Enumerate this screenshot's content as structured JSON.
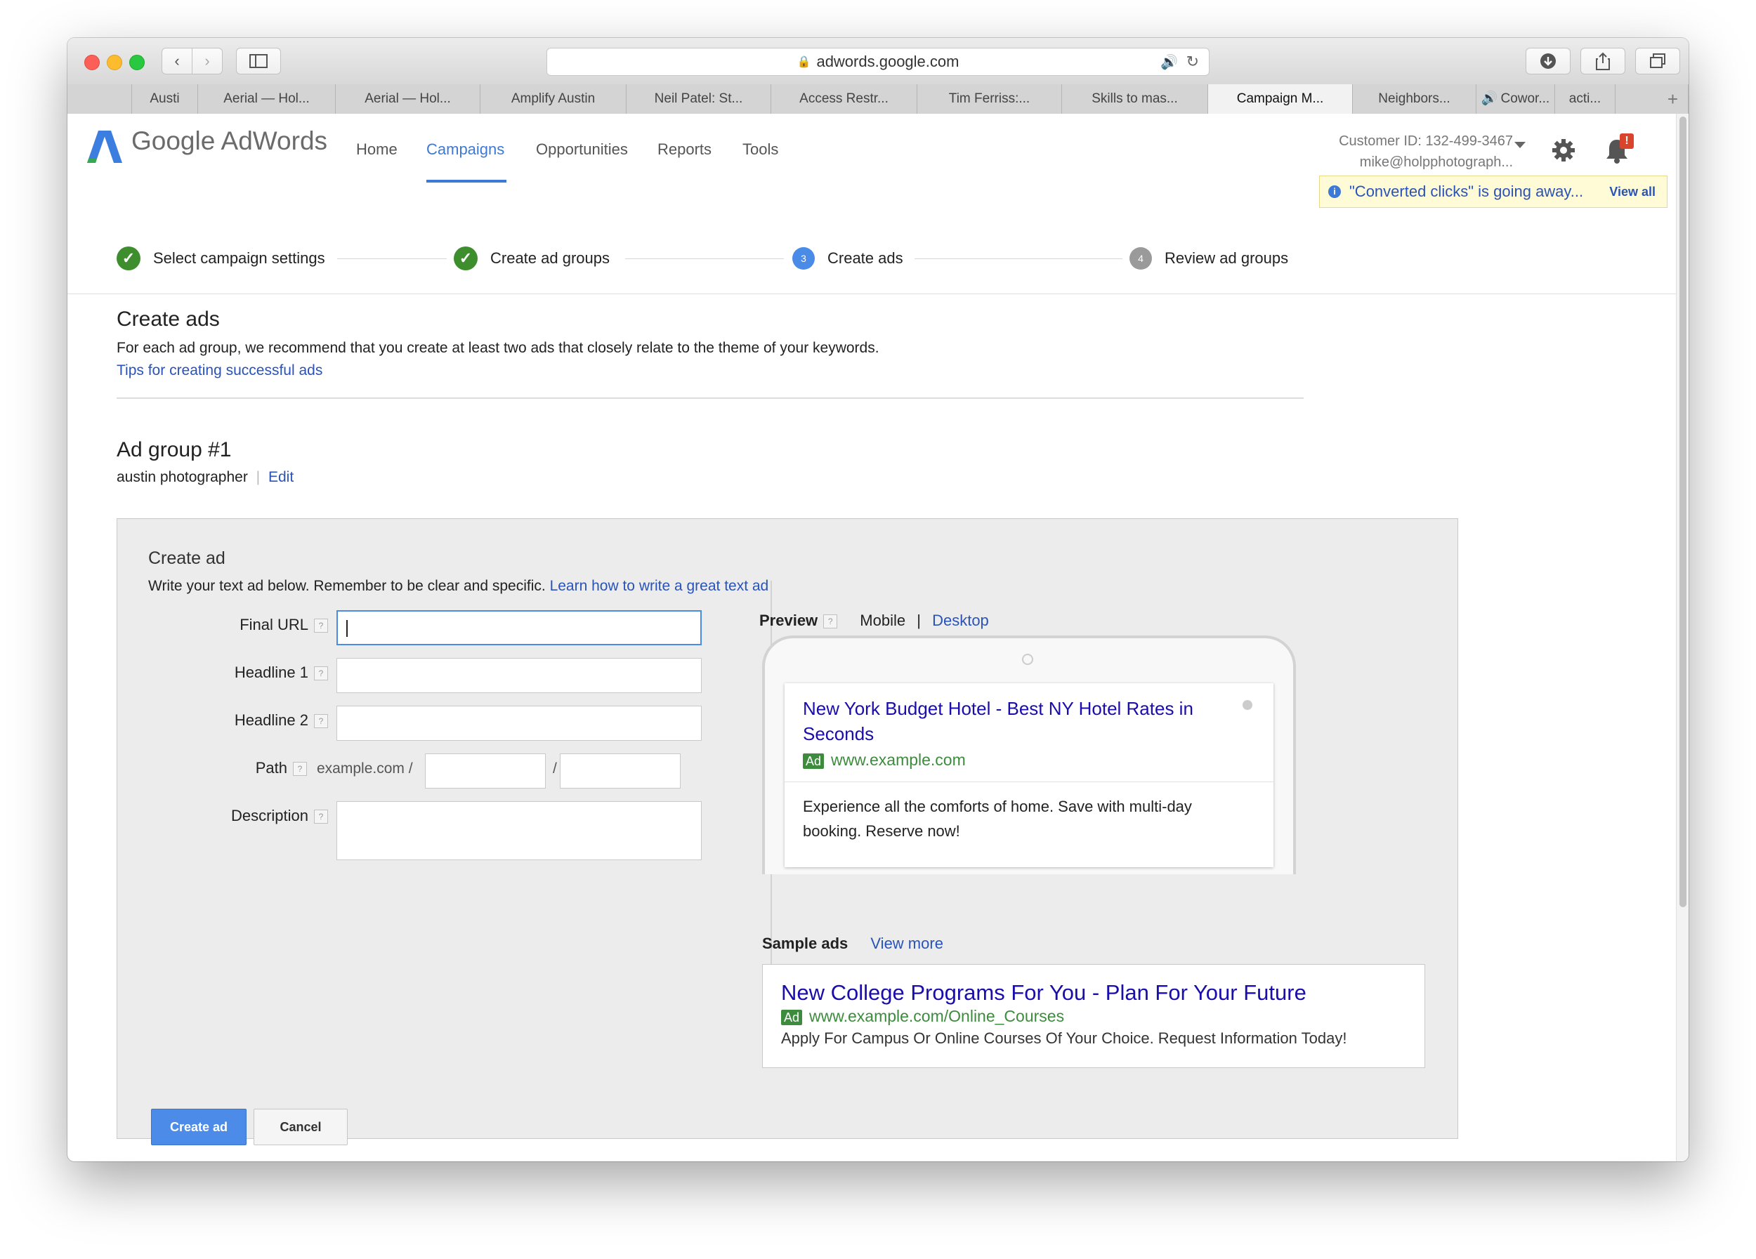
{
  "browser": {
    "url": "adwords.google.com",
    "tabs": [
      "Austi",
      "Aerial — Hol...",
      "Aerial — Hol...",
      "Amplify Austin",
      "Neil Patel: St...",
      "Access Restr...",
      "Tim Ferriss:...",
      "Skills to mas...",
      "Campaign M...",
      "Neighbors...",
      "Cowor...",
      "acti..."
    ],
    "new_tab": "+"
  },
  "header": {
    "logo": "Google AdWords",
    "nav": [
      "Home",
      "Campaigns",
      "Opportunities",
      "Reports",
      "Tools"
    ],
    "active_nav": "Campaigns",
    "customer_id": "Customer ID: 132-499-3467",
    "email": "mike@holpphotograph...",
    "notification_badge": "!",
    "notice_text": "\"Converted clicks\" is going away...",
    "notice_link": "View all"
  },
  "steps": [
    {
      "label": "Select campaign settings",
      "state": "done",
      "marker": "✓"
    },
    {
      "label": "Create ad groups",
      "state": "done",
      "marker": "✓"
    },
    {
      "label": "Create ads",
      "state": "current",
      "marker": "3"
    },
    {
      "label": "Review ad groups",
      "state": "pending",
      "marker": "4"
    }
  ],
  "page": {
    "title": "Create ads",
    "intro": "For each ad group, we recommend that you create at least two ads that closely relate to the theme of your keywords.",
    "tips_link": "Tips for creating successful ads",
    "ad_group_title": "Ad group #1",
    "ad_group_keyword": "austin photographer",
    "edit_link": "Edit"
  },
  "form": {
    "title": "Create ad",
    "instructions": "Write your text ad below. Remember to be clear and specific.",
    "learn_link": "Learn how to write a great text ad",
    "help_glyph": "?",
    "labels": {
      "final_url": "Final URL",
      "headline1": "Headline 1",
      "headline2": "Headline 2",
      "path": "Path",
      "description": "Description"
    },
    "path_prefix": "example.com /",
    "path_separator": "/",
    "values": {
      "final_url": "",
      "headline1": "",
      "headline2": "",
      "path1": "",
      "path2": "",
      "description": ""
    },
    "create_button": "Create ad",
    "cancel_button": "Cancel"
  },
  "preview": {
    "label": "Preview",
    "mobile": "Mobile",
    "separator": "|",
    "desktop": "Desktop",
    "ad": {
      "headline": "New York Budget Hotel - Best NY Hotel Rates in Seconds",
      "badge": "Ad",
      "url": "www.example.com",
      "description": "Experience all the comforts of home. Save with multi-day booking. Reserve now!"
    }
  },
  "sample": {
    "label": "Sample ads",
    "view_more": "View more",
    "ad": {
      "headline": "New College Programs For You - Plan For Your Future",
      "badge": "Ad",
      "url": "www.example.com/Online_Courses",
      "description": "Apply For Campus Or Online Courses Of Your Choice. Request Information Today!"
    }
  },
  "colors": {
    "accent": "#3d79d7",
    "done": "#3e8e2e",
    "ad_green": "#3d8c3d",
    "link": "#2a53b8"
  }
}
